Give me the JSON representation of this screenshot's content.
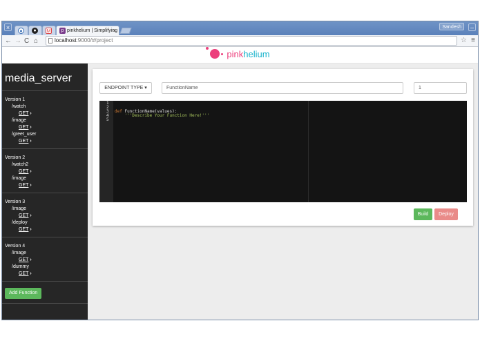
{
  "browser": {
    "tabs": [
      {
        "label": ""
      },
      {
        "label": ""
      },
      {
        "label": ""
      },
      {
        "label": "pinkhelium | Simplifying"
      }
    ],
    "user": "Sandesh",
    "url_host": "localhost",
    "url_path": ":9000/#/project"
  },
  "brand": {
    "part1": "pink",
    "part2": "helium"
  },
  "sidebar": {
    "project": "media_server",
    "versions": [
      {
        "label": "Version 1",
        "routes": [
          {
            "path": "/watch",
            "method": "GET"
          },
          {
            "path": "/image",
            "method": "GET"
          },
          {
            "path": "/greet_user",
            "method": "GET"
          }
        ]
      },
      {
        "label": "Version 2",
        "routes": [
          {
            "path": "/watch2",
            "method": "GET"
          },
          {
            "path": "/image",
            "method": "GET"
          }
        ]
      },
      {
        "label": "Version 3",
        "routes": [
          {
            "path": "/image",
            "method": "GET"
          },
          {
            "path": "/deploy",
            "method": "GET"
          }
        ]
      },
      {
        "label": "Version 4",
        "routes": [
          {
            "path": "/image",
            "method": "GET"
          },
          {
            "path": "/dummy",
            "method": "GET"
          }
        ]
      }
    ],
    "add_button": "Add Function"
  },
  "editor_panel": {
    "endpoint_type": "ENDPOINT TYPE",
    "function_name_placeholder": "FunctionName",
    "version_value": "1",
    "line_numbers": [
      "1",
      "2",
      "3",
      "4",
      "5"
    ],
    "code": {
      "kw": "def",
      "sig": " FunctionName(values):",
      "doc": "'''Describe Your Function Here!'''"
    },
    "build": "Build",
    "deploy": "Deploy"
  },
  "colors": {
    "brand_pink": "#ec3f7c",
    "brand_cyan": "#19b3cc",
    "success": "#5cb85c",
    "danger_light": "#e98b89",
    "sidebar_bg": "#262626"
  }
}
